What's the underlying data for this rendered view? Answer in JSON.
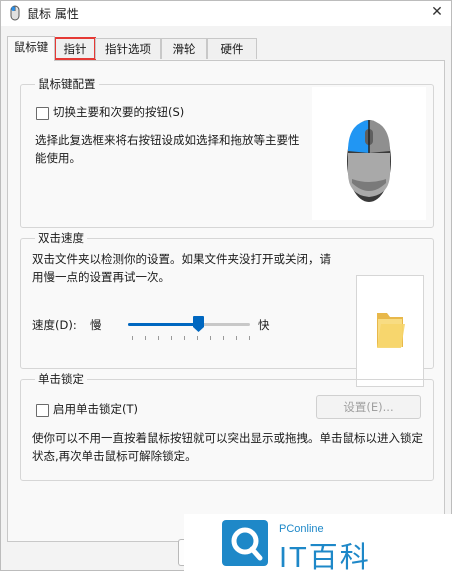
{
  "window": {
    "title": "鼠标 属性",
    "close_glyph": "✕"
  },
  "tabs": [
    {
      "label": "鼠标键",
      "active": true
    },
    {
      "label": "指针",
      "active": false,
      "highlighted": true
    },
    {
      "label": "指针选项",
      "active": false
    },
    {
      "label": "滑轮",
      "active": false
    },
    {
      "label": "硬件",
      "active": false
    }
  ],
  "button_config": {
    "title": "鼠标键配置",
    "switch_checkbox_label": "切换主要和次要的按钮(S)",
    "switch_checked": false,
    "description": "选择此复选框来将右按钮设成如选择和拖放等主要性能使用。",
    "mouse_image_icon": "mouse-icon"
  },
  "double_click": {
    "title": "双击速度",
    "description": "双击文件夹以检测你的设置。如果文件夹没打开或关闭，请用慢一点的设置再试一次。",
    "speed_label": "速度(D):",
    "slow_label": "慢",
    "fast_label": "快",
    "speed_value_fraction": 0.58,
    "test_folder_icon": "folder-icon"
  },
  "click_lock": {
    "title": "单击锁定",
    "checkbox_label": "启用单击锁定(T)",
    "checked": false,
    "settings_button": "设置(E)...",
    "description": "使你可以不用一直按着鼠标按钮就可以突出显示或拖拽。单击鼠标以进入锁定状态,再次单击鼠标可解除锁定。"
  },
  "watermark": {
    "brand_small": "PConline",
    "brand_large": "IT百科"
  },
  "colors": {
    "accent": "#0067c0",
    "highlight": "#e53935",
    "brand": "#1e88c8"
  }
}
